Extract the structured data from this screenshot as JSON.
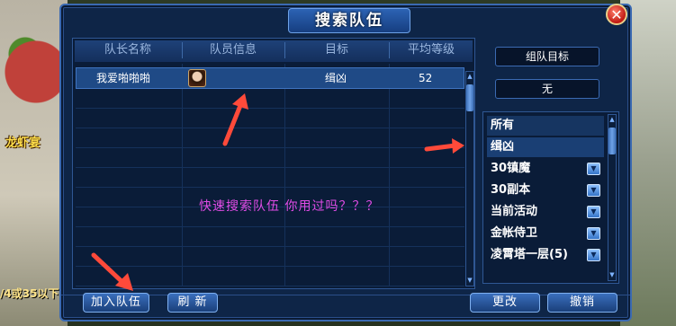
{
  "background": {
    "left_label": "龙虾宴",
    "bottom_text": "/4或35以下"
  },
  "window": {
    "title": "搜索队伍",
    "close_glyph": "✕"
  },
  "table": {
    "headers": [
      "队长名称",
      "队员信息",
      "目标",
      "平均等级"
    ],
    "rows": [
      {
        "leader": "我爱啪啪啪",
        "target": "缉凶",
        "avg_level": "52"
      }
    ]
  },
  "overlay_annotation": "快速搜索队伍 你用过吗？？？",
  "sidebar": {
    "goal_label": "组队目标",
    "goal_value": "无",
    "categories": [
      {
        "label": "所有",
        "dropdown": false
      },
      {
        "label": "缉凶",
        "dropdown": false
      },
      {
        "label": "30镇魔",
        "dropdown": true
      },
      {
        "label": "30副本",
        "dropdown": true
      },
      {
        "label": "当前活动",
        "dropdown": true
      },
      {
        "label": "金帐侍卫",
        "dropdown": true
      },
      {
        "label": "凌霄塔一层(5)",
        "dropdown": true
      }
    ]
  },
  "buttons": {
    "join": "加入队伍",
    "refresh": "刷 新",
    "change": "更改",
    "cancel": "撤销"
  },
  "colors": {
    "annotation": "#e04ce6",
    "arrow": "#ff4a3a",
    "panel": "#0e2547"
  }
}
